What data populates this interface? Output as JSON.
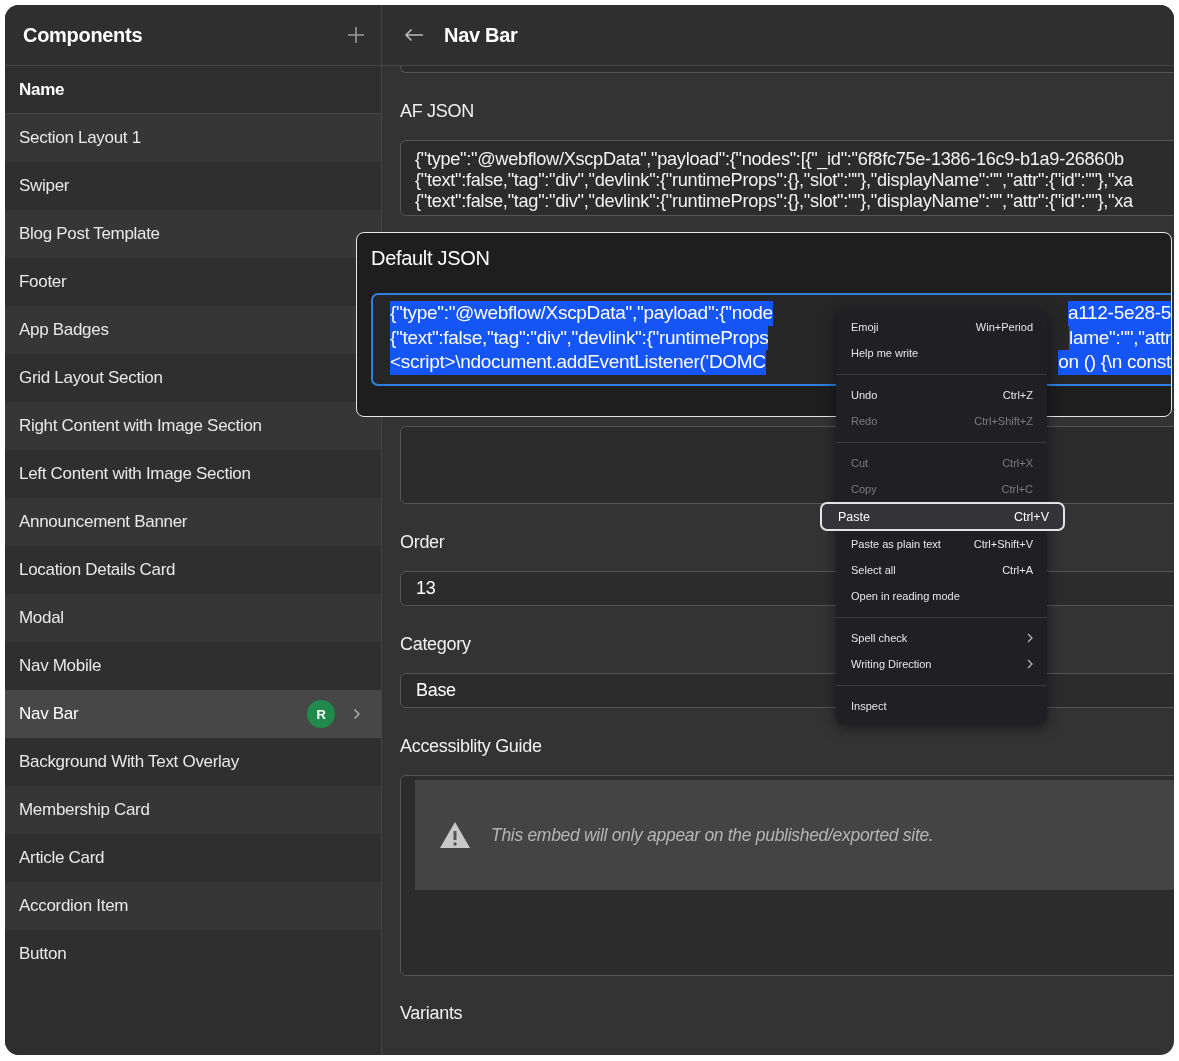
{
  "sidebar": {
    "title": "Components",
    "column_header": "Name",
    "items": [
      {
        "label": "Section Layout 1",
        "selected": false
      },
      {
        "label": "Swiper",
        "selected": false
      },
      {
        "label": "Blog Post Template",
        "selected": false
      },
      {
        "label": "Footer",
        "selected": false
      },
      {
        "label": "App Badges",
        "selected": false
      },
      {
        "label": "Grid Layout Section",
        "selected": false
      },
      {
        "label": "Right Content with Image Section",
        "selected": false
      },
      {
        "label": "Left Content with Image Section",
        "selected": false
      },
      {
        "label": "Announcement Banner",
        "selected": false
      },
      {
        "label": "Location Details Card",
        "selected": false
      },
      {
        "label": "Modal",
        "selected": false
      },
      {
        "label": "Nav Mobile",
        "selected": false
      },
      {
        "label": "Nav Bar",
        "selected": true,
        "badge": "R"
      },
      {
        "label": "Background With Text Overlay",
        "selected": false
      },
      {
        "label": "Membership Card",
        "selected": false
      },
      {
        "label": "Article Card",
        "selected": false
      },
      {
        "label": "Accordion Item",
        "selected": false
      },
      {
        "label": "Button",
        "selected": false
      }
    ]
  },
  "editor": {
    "title": "Nav Bar",
    "fields": [
      {
        "kind": "stub"
      },
      {
        "kind": "code",
        "label": "AF JSON",
        "lines": [
          "{\"type\":\"@webflow/XscpData\",\"payload\":{\"nodes\":[{\"_id\":\"6f8fc75e-1386-16c9-b1a9-26860b",
          "{\"text\":false,\"tag\":\"div\",\"devlink\":{\"runtimeProps\":{},\"slot\":\"\"},\"displayName\":\"\",\"attr\":{\"id\":\"\"},\"xa",
          "{\"text\":false,\"tag\":\"div\",\"devlink\":{\"runtimeProps\":{},\"slot\":\"\"},\"displayName\":\"\",\"attr\":{\"id\":\"\"},\"xa"
        ]
      },
      {
        "kind": "empty"
      },
      {
        "kind": "text",
        "label": "Order",
        "value": "13"
      },
      {
        "kind": "text",
        "label": "Category",
        "value": "Base"
      },
      {
        "kind": "notice",
        "label": "Accessiblity Guide",
        "message": "This embed will only appear on the published/exported site."
      },
      {
        "kind": "heading",
        "label": "Variants"
      }
    ]
  },
  "modal": {
    "title": "Default JSON",
    "lines": [
      {
        "left": "{\"type\":\"@webflow/XscpData\",\"payload\":{\"node",
        "right": "a112-5e28-5"
      },
      {
        "left": "{\"text\":false,\"tag\":\"div\",\"devlink\":{\"runtimeProps",
        "right": "lame\":\"\",\"attr"
      },
      {
        "left": "<script>\\ndocument.addEventListener('DOMC",
        "right": "on () {\\n const"
      }
    ]
  },
  "context_menu": {
    "items": [
      {
        "kind": "item",
        "label": "Emoji",
        "shortcut": "Win+Period",
        "disabled": false,
        "selected": false
      },
      {
        "kind": "item",
        "label": "Help me write",
        "disabled": false,
        "selected": false
      },
      {
        "kind": "separator"
      },
      {
        "kind": "item",
        "label": "Undo",
        "shortcut": "Ctrl+Z",
        "disabled": false,
        "selected": false
      },
      {
        "kind": "item",
        "label": "Redo",
        "shortcut": "Ctrl+Shift+Z",
        "disabled": true,
        "selected": false
      },
      {
        "kind": "separator"
      },
      {
        "kind": "item",
        "label": "Cut",
        "shortcut": "Ctrl+X",
        "disabled": true,
        "selected": false
      },
      {
        "kind": "item",
        "label": "Copy",
        "shortcut": "Ctrl+C",
        "disabled": true,
        "selected": false
      },
      {
        "kind": "item",
        "label": "Paste",
        "shortcut": "Ctrl+V",
        "disabled": false,
        "selected": true
      },
      {
        "kind": "item",
        "label": "Paste as plain text",
        "shortcut": "Ctrl+Shift+V",
        "disabled": false,
        "selected": false
      },
      {
        "kind": "item",
        "label": "Select all",
        "shortcut": "Ctrl+A",
        "disabled": false,
        "selected": false
      },
      {
        "kind": "item",
        "label": "Open in reading mode",
        "disabled": false,
        "selected": false
      },
      {
        "kind": "separator"
      },
      {
        "kind": "submenu",
        "label": "Spell check"
      },
      {
        "kind": "submenu",
        "label": "Writing Direction"
      },
      {
        "kind": "separator"
      },
      {
        "kind": "item",
        "label": "Inspect",
        "disabled": false,
        "selected": false
      }
    ]
  }
}
